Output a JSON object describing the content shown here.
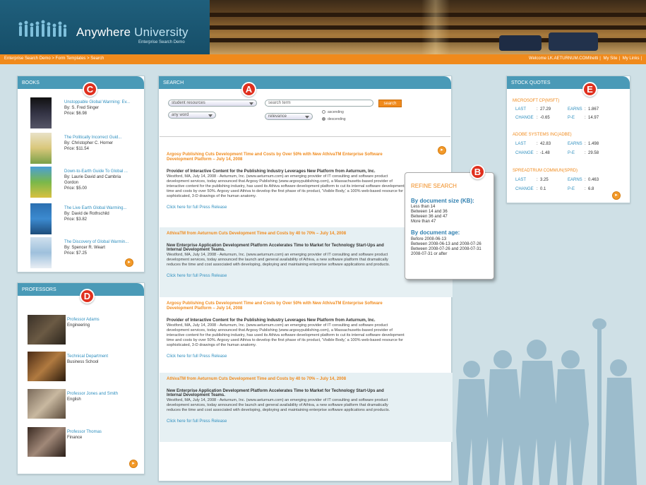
{
  "header": {
    "title_part1": "Anywhere ",
    "title_part2": "University",
    "subtitle": "Enterprise Search Demo"
  },
  "nav": {
    "breadcrumb": "Enterprise Search Demo > Form Templates > Search",
    "welcome": "Welcome LK.AETURNUM.COM\\hetti",
    "my_site": "My Site",
    "my_links": "My Links"
  },
  "callouts": {
    "a": "A",
    "b": "B",
    "c": "C",
    "d": "D",
    "e": "E"
  },
  "books": {
    "heading": "BOOKS",
    "items": [
      {
        "title": "Unstoppable Global Warming: Ev...",
        "author": "By: S. Fred Singer",
        "price": "Price: $6.98"
      },
      {
        "title": "The Politically Incorrect Guid...",
        "author": "By: Christopher C. Horner",
        "price": "Price: $11.54"
      },
      {
        "title": "Down-to-Earth Guide To Global ...",
        "author": "By: Laurie David and Cambria",
        "author2": "Gordon",
        "price": "Price: $5.00"
      },
      {
        "title": "The Live Earth Global Warming...",
        "author": "By: David de Rothschild",
        "price": "Price: $3.82"
      },
      {
        "title": "The Discovery of Global Warmin...",
        "author": "By: Spencer R. Weart",
        "price": "Price: $7.25"
      }
    ]
  },
  "professors": {
    "heading": "PROFESSORS",
    "items": [
      {
        "name": "Professor Adams",
        "dept": "Engineering"
      },
      {
        "name": "Technical Department",
        "dept": "Business School"
      },
      {
        "name": "Professor Jones and Smith",
        "dept": "English"
      },
      {
        "name": "Professor Thomas",
        "dept": "Finance"
      }
    ]
  },
  "search": {
    "heading": "SEARCH",
    "scope": "student resources",
    "term_placeholder": "search term",
    "match": "any word",
    "sort": "relevance",
    "button": "search",
    "ascending": "ascending",
    "descending": "descending"
  },
  "results": [
    {
      "title": "Argosy Publishing Cuts Development Time and Costs by Over 50% with New AthivaTM Enterprise Software Development Platform – July 14, 2008",
      "subtitle": "Provider of Interactive Content for the Publishing Industry Leverages New Platform from Aeturnum, Inc.",
      "body": "Westford, MA, July 14, 2008 - Aeturnum, Inc. (www.aeturnum.com) an emerging provider of IT consulting and software product development services, today announced that Argosy Publishing (www.argosypublishing.com), a Massachusetts-based provider of interactive content for the publishing industry, has used its Athiva software development platform to cut its internal software development time and costs by over 50%. Argosy used Athiva to develop the first phase of its product, 'Visible Body,' a 100% web-based resource for sophisticated, 3-D drawings of the human anatomy.",
      "link": "Click here for full Press Release"
    },
    {
      "title": "AthivaTM from Aeturnum Cuts Development Time and Costs by 40 to 70% – July 14, 2008",
      "subtitle": "New Enterprise Application Development Platform Accelerates Time to Market for Technology Start-Ups and Internal Development Teams.",
      "body": "Westford, MA, July 14, 2008 - Aeturnum, Inc. (www.aeturnum.com) an emerging provider of IT consulting and software product development services, today announced the launch and general availability of Athiva, a new software platform that dramatically reduces the time and cost associated with developing, deploying and maintaining enterprise software applications and products.",
      "link": "Click here for full Press Release"
    },
    {
      "title": "Argosy Publishing Cuts Development Time and Costs by Over 50% with New AthivaTM Enterprise Software Development Platform – July 14, 2008",
      "subtitle": "Provider of Interactive Content for the Publishing Industry Leverages New Platform from Aeturnum, Inc.",
      "body": "Westford, MA, July 14, 2008 - Aeturnum, Inc. (www.aeturnum.com) an emerging provider of IT consulting and software product development services, today announced that Argosy Publishing (www.argosypublishing.com), a Massachusetts-based provider of interactive content for the publishing industry, has used its Athiva software development platform to cut its internal software development time and costs by over 50%. Argosy used Athiva to develop the first phase of its product, 'Visible Body,' a 100% web-based resource for sophisticated, 3-D drawings of the human anatomy.",
      "link": "Click here for full Press Release"
    },
    {
      "title": "AthivaTM from Aeturnum Cuts Development Time and Costs by 40 to 70% – July 14, 2008",
      "subtitle": "New Enterprise Application Development Platform Accelerates Time to Market for Technology Start-Ups and Internal Development Teams.",
      "body": "Westford, MA, July 14, 2008 - Aeturnum, Inc. (www.aeturnum.com) an emerging provider of IT consulting and software product development services, today announced the launch and general availability of Athiva, a new software platform that dramatically reduces the time and cost associated with developing, deploying and maintaining enterprise software applications and products.",
      "link": "Click here for full Press Release"
    }
  ],
  "refine": {
    "title": "REFINE SEARCH",
    "size_heading": "By document size (KB):",
    "size_options": [
      "Less than 14",
      "Between 14 and 36",
      "Between 36 and 47",
      "More than 47"
    ],
    "age_heading": "By document age:",
    "age_options": [
      "Before 2008-06-13",
      "Between 2008-06-13 and 2008-07-26",
      "Between 2008-07-26 and 2008-07-31",
      "2008-07-31 or after"
    ]
  },
  "stocks": {
    "heading": "STOCK QUOTES",
    "labels": {
      "last": "LAST",
      "change": "CHANGE",
      "earns": "EARNS",
      "pe": "P-E"
    },
    "items": [
      {
        "name": "MICROSOFT CP(MSFT)",
        "last": "27.29",
        "change": "-0.65",
        "earns": "1.867",
        "pe": "14.97"
      },
      {
        "name": "ADOBE SYSTEMS INC(ADBE)",
        "last": "42.83",
        "change": "-1.48",
        "earns": "1.498",
        "pe": "29.58"
      },
      {
        "name": "SPREADTRUM COMMUN(SPRD)",
        "last": "3.25",
        "change": "0.1",
        "earns": "0.463",
        "pe": "6.8"
      }
    ]
  },
  "colors": {
    "brand": "#1f5f7c",
    "accent": "#f08a1c",
    "panel_header": "#4a9ab7",
    "callout": "#e0301e"
  },
  "icons": {
    "more": "arrow-right-icon",
    "select": "chevron-down-icon"
  }
}
